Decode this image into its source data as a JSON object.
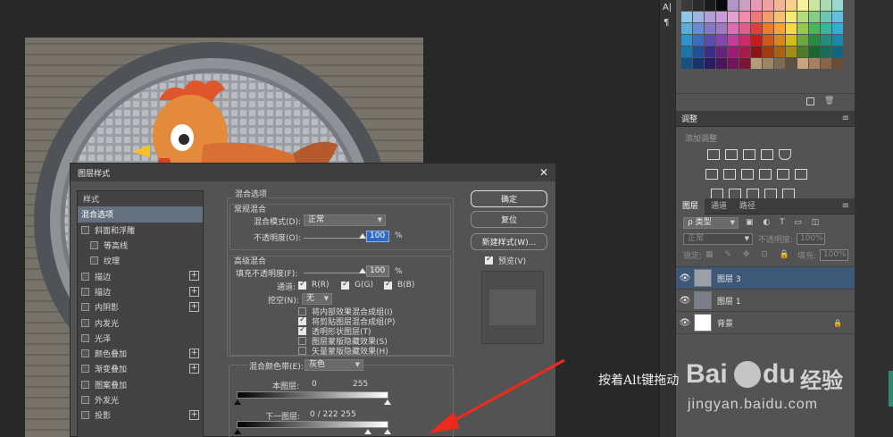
{
  "dialog": {
    "title": "图层样式",
    "close_glyph": "✕",
    "style_list": {
      "header": "样式",
      "items": [
        {
          "label": "混合选项",
          "checkbox": false,
          "checked": false,
          "plus": false,
          "active": true,
          "indent": 0
        },
        {
          "label": "斜面和浮雕",
          "checkbox": true,
          "checked": false,
          "plus": false,
          "active": false,
          "indent": 0
        },
        {
          "label": "等高线",
          "checkbox": true,
          "checked": false,
          "plus": false,
          "active": false,
          "indent": 1
        },
        {
          "label": "纹理",
          "checkbox": true,
          "checked": false,
          "plus": false,
          "active": false,
          "indent": 1
        },
        {
          "label": "描边",
          "checkbox": true,
          "checked": false,
          "plus": true,
          "active": false,
          "indent": 0
        },
        {
          "label": "描边",
          "checkbox": true,
          "checked": false,
          "plus": true,
          "active": false,
          "indent": 0
        },
        {
          "label": "内阴影",
          "checkbox": true,
          "checked": false,
          "plus": true,
          "active": false,
          "indent": 0
        },
        {
          "label": "内发光",
          "checkbox": true,
          "checked": false,
          "plus": false,
          "active": false,
          "indent": 0
        },
        {
          "label": "光泽",
          "checkbox": true,
          "checked": false,
          "plus": false,
          "active": false,
          "indent": 0
        },
        {
          "label": "颜色叠加",
          "checkbox": true,
          "checked": false,
          "plus": true,
          "active": false,
          "indent": 0
        },
        {
          "label": "渐变叠加",
          "checkbox": true,
          "checked": false,
          "plus": true,
          "active": false,
          "indent": 0
        },
        {
          "label": "图案叠加",
          "checkbox": true,
          "checked": false,
          "plus": false,
          "active": false,
          "indent": 0
        },
        {
          "label": "外发光",
          "checkbox": true,
          "checked": false,
          "plus": false,
          "active": false,
          "indent": 0
        },
        {
          "label": "投影",
          "checkbox": true,
          "checked": false,
          "plus": true,
          "active": false,
          "indent": 0
        }
      ]
    },
    "blend_options": {
      "section_title": "混合选项",
      "general_title": "常规混合",
      "blend_mode_label": "混合模式(D):",
      "blend_mode_value": "正常",
      "opacity_label": "不透明度(O):",
      "opacity_value": "100",
      "percent": "%",
      "advanced_title": "高级混合",
      "fill_opacity_label": "填充不透明度(F):",
      "fill_opacity_value": "100",
      "channels_label": "通道:",
      "channel_r": "R(R)",
      "channel_g": "G(G)",
      "channel_b": "B(B)",
      "knockout_label": "挖空(N):",
      "knockout_value": "无",
      "options": [
        {
          "label": "将内部效果混合成组(I)",
          "checked": false
        },
        {
          "label": "将剪贴图层混合成组(P)",
          "checked": true
        },
        {
          "label": "透明形状图层(T)",
          "checked": true
        },
        {
          "label": "图层蒙版隐藏效果(S)",
          "checked": false
        },
        {
          "label": "矢量蒙版隐藏效果(H)",
          "checked": false
        }
      ],
      "blend_if_label": "混合颜色带(E):",
      "blend_if_value": "灰色",
      "this_layer_label": "本图层:",
      "this_layer_min": "0",
      "this_layer_max": "255",
      "underlying_label": "下一图层:",
      "underlying_values": "0  /  222   255"
    },
    "buttons": {
      "ok": "确定",
      "reset": "复位",
      "new_style": "新建样式(W)...",
      "preview": "预览(V)"
    }
  },
  "panels": {
    "adjustments": {
      "title": "调整",
      "add_label": "添加调整"
    },
    "layers": {
      "tabs": [
        "图层",
        "通道",
        "路径"
      ],
      "filter_label": "ρ 类型",
      "blend_mode": "正常",
      "opacity_label": "不透明度:",
      "opacity_value": "100%",
      "lock_label": "锁定:",
      "fill_label": "填充:",
      "fill_value": "100%",
      "items": [
        {
          "name": "图层 3",
          "selected": true
        },
        {
          "name": "图层 1",
          "selected": false
        },
        {
          "name": "背景",
          "selected": false
        }
      ]
    },
    "strip_glyphs": [
      "A|",
      "¶"
    ]
  },
  "annotation": "按着Alt键拖动",
  "watermark": {
    "brand_left": "Bai",
    "brand_right": "du",
    "chinese": "经验",
    "url": "jingyan.baidu.com"
  },
  "swatch_colors": [
    "#3a3a3a",
    "#2a2a2a",
    "#1a1a1a",
    "#0a0a0a",
    "#b494c4",
    "#c8a0c0",
    "#e89ab4",
    "#f0a0a0",
    "#f4b496",
    "#f8d08c",
    "#f8f09c",
    "#c8e8a0",
    "#a8dcb0",
    "#9cd8d0",
    "#8cc8e8",
    "#a0b4e0",
    "#b4a0d8",
    "#c89cd8",
    "#e8a0d0",
    "#f08cb0",
    "#f07878",
    "#f49c6c",
    "#f8c070",
    "#f8e878",
    "#b4dc78",
    "#84cc88",
    "#6cc8b4",
    "#64c0e0",
    "#5cacdc",
    "#6c8cd0",
    "#8478c4",
    "#a078c4",
    "#d870b4",
    "#e45c8c",
    "#e43c3c",
    "#ec7838",
    "#f4a43c",
    "#f4dc40",
    "#94c850",
    "#4cb45c",
    "#3cb49c",
    "#34acd4",
    "#2c94cc",
    "#3c6cbc",
    "#5c4cac",
    "#8448ac",
    "#c43c9c",
    "#d0286c",
    "#c41c1c",
    "#d0581c",
    "#d88420",
    "#d4bc20",
    "#6ca83c",
    "#288c44",
    "#20907c",
    "#1c88a8",
    "#1c74a8",
    "#244c98",
    "#3c2c88",
    "#64247c",
    "#9c1c74",
    "#a41c4c",
    "#8c1414",
    "#9c3c10",
    "#a46414",
    "#a48c18",
    "#4c7c28",
    "#1c6430",
    "#186c5c",
    "#146480",
    "#145080",
    "#183470",
    "#281c64",
    "#4c145c",
    "#74145c",
    "#7c1438",
    "#b49c74",
    "#9c8464",
    "#7c6c54",
    "#5c5040",
    "#c8a47c",
    "#a88060",
    "#886448",
    "#684c34"
  ]
}
